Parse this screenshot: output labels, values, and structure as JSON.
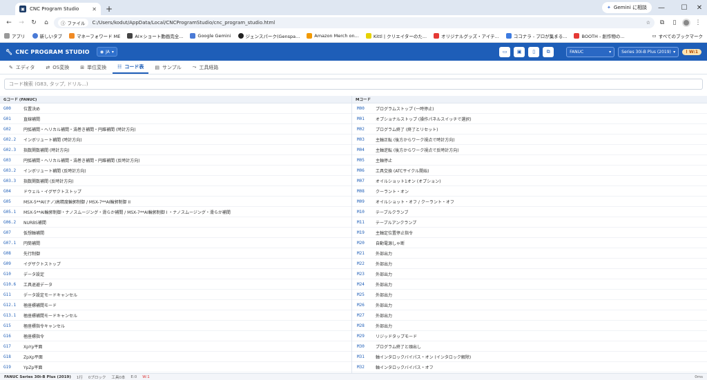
{
  "browser": {
    "tab_title": "CNC Program Studio",
    "gemini_label": "Gemini に相談",
    "url_chip": "ファイル",
    "url": "C:/Users/kodut/AppData/Local/CNCProgramStudio/cnc_program_studio.html",
    "bookmarks": [
      "アプリ",
      "新しいタブ",
      "マネーフォワード ME",
      "AI×ショート動画完全...",
      "Google Gemini",
      "ジェンスパーク(Genspa...",
      "Amazon Merch on...",
      "Kittl | クリエイターのた...",
      "オリジナルグッズ・アイテ...",
      "ココナラ - プロが集まる...",
      "BOOTH - 創作物の..."
    ],
    "bookmarks_all": "すべてのブックマーク"
  },
  "app": {
    "title": "CNC PROGRAM STUDIO",
    "lang": "JA",
    "controller": "FANUC",
    "series": "Series 30i-B Plus (2019)",
    "warn": "! W:1"
  },
  "tabs": [
    {
      "label": "エディタ",
      "icon": "✎"
    },
    {
      "label": "OS変換",
      "icon": "⇄"
    },
    {
      "label": "単位変換",
      "icon": "⊞"
    },
    {
      "label": "コード表",
      "icon": "☷"
    },
    {
      "label": "サンプル",
      "icon": "▤"
    },
    {
      "label": "工具経路",
      "icon": "⤳"
    }
  ],
  "search": {
    "placeholder": "コード検索 (G83, タップ, ドリル...)"
  },
  "gcodes": {
    "header": "Gコード (FANUC)",
    "rows": [
      {
        "code": "G00",
        "desc": "位置決め"
      },
      {
        "code": "G01",
        "desc": "直線補間"
      },
      {
        "code": "G02",
        "desc": "円弧補間・ヘリカル補間・渦巻き補間・円錐補間 (時計方向)"
      },
      {
        "code": "G02.2",
        "desc": "インボリュート補間 (時計方向)"
      },
      {
        "code": "G02.3",
        "desc": "指数関数補間 (時計方向)"
      },
      {
        "code": "G03",
        "desc": "円弧補間・ヘリカル補間・渦巻き補間・円錐補間 (反時計方向)"
      },
      {
        "code": "G03.2",
        "desc": "インボリュート補間 (反時計方向)"
      },
      {
        "code": "G03.3",
        "desc": "指数関数補間 (反時計方向)"
      },
      {
        "code": "G04",
        "desc": "ドウェル・イグザクトストップ"
      },
      {
        "code": "G05",
        "desc": "MSX-5**AI(ナノ)高精度輪郭制御 / MSX-7**AI輪郭制御 II"
      },
      {
        "code": "G05.1",
        "desc": "MSX-5**AI輪郭制御・ナノスムージング・滑らか補間 / MSX-7**AI輪郭制御 I ・ナノスムージング・滑らか補間"
      },
      {
        "code": "G06.2",
        "desc": "NURBS補間"
      },
      {
        "code": "G07",
        "desc": "仮想軸補間"
      },
      {
        "code": "G07.1",
        "desc": "円筒補間"
      },
      {
        "code": "G08",
        "desc": "先行制御"
      },
      {
        "code": "G09",
        "desc": "イグザクトストップ"
      },
      {
        "code": "G10",
        "desc": "データ設定"
      },
      {
        "code": "G10.6",
        "desc": "工具退避データ"
      },
      {
        "code": "G11",
        "desc": "データ設定モードキャンセル"
      },
      {
        "code": "G12.1",
        "desc": "極座標補間モード"
      },
      {
        "code": "G13.1",
        "desc": "極座標補間モードキャンセル"
      },
      {
        "code": "G15",
        "desc": "極座標指令キャンセル"
      },
      {
        "code": "G16",
        "desc": "極座標指令"
      },
      {
        "code": "G17",
        "desc": "XpYp平面"
      },
      {
        "code": "G18",
        "desc": "ZpXp平面"
      },
      {
        "code": "G19",
        "desc": "YpZp平面"
      }
    ]
  },
  "mcodes": {
    "header": "Mコード",
    "rows": [
      {
        "code": "M00",
        "desc": "プログラムストップ (一時停止)"
      },
      {
        "code": "M01",
        "desc": "オプショナルストップ (操作パネルスイッチで選択)"
      },
      {
        "code": "M02",
        "desc": "プログラム終了 (終了とリセット)"
      },
      {
        "code": "M03",
        "desc": "主軸正転 (後方からワーク視点で時計方向)"
      },
      {
        "code": "M04",
        "desc": "主軸逆転 (後方からワーク視点で反時計方向)"
      },
      {
        "code": "M05",
        "desc": "主軸停止"
      },
      {
        "code": "M06",
        "desc": "工具交換 (ATCサイクル開始)"
      },
      {
        "code": "M07",
        "desc": "オイルショット1オン (オプション)"
      },
      {
        "code": "M08",
        "desc": "クーラント・オン"
      },
      {
        "code": "M09",
        "desc": "オイルショット・オフ / クーラント・オフ"
      },
      {
        "code": "M10",
        "desc": "テーブルクランプ"
      },
      {
        "code": "M11",
        "desc": "テーブルアンクランプ"
      },
      {
        "code": "M19",
        "desc": "主軸定位置停止指令"
      },
      {
        "code": "M20",
        "desc": "自動電源しゃ断"
      },
      {
        "code": "M21",
        "desc": "外部出力"
      },
      {
        "code": "M22",
        "desc": "外部出力"
      },
      {
        "code": "M23",
        "desc": "外部出力"
      },
      {
        "code": "M24",
        "desc": "外部出力"
      },
      {
        "code": "M25",
        "desc": "外部出力"
      },
      {
        "code": "M26",
        "desc": "外部出力"
      },
      {
        "code": "M27",
        "desc": "外部出力"
      },
      {
        "code": "M28",
        "desc": "外部出力"
      },
      {
        "code": "M29",
        "desc": "リジッドタップモード"
      },
      {
        "code": "M30",
        "desc": "プログラム終了と頭出し"
      },
      {
        "code": "M31",
        "desc": "軸インタロックバイパス・オン (インタロック解除)"
      },
      {
        "code": "M32",
        "desc": "軸インタロックバイパス・オフ"
      }
    ]
  },
  "status": {
    "series": "FANUC Series 30i-B Plus (2019)",
    "lines": "1行",
    "blocks": "0ブロック",
    "tools": "工具0本",
    "errors": "E:0",
    "warnings": "W:1",
    "time": "0ms"
  }
}
